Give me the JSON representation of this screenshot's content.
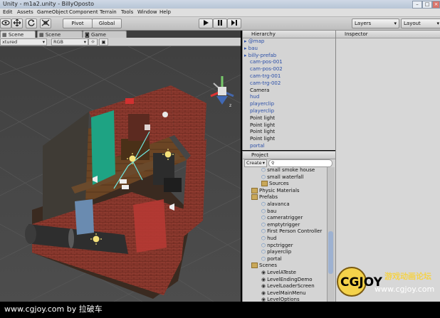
{
  "window": {
    "title": "Unity - m1a2.unity - BillyOposto"
  },
  "menu": [
    "Edit",
    "Assets",
    "GameObject",
    "Component",
    "Terrain",
    "Tools",
    "Window",
    "Help"
  ],
  "toolbar": {
    "pivot": "Pivot",
    "global": "Global",
    "layers": "Layers",
    "layout": "Layout"
  },
  "scene": {
    "tab_scene": "Scene",
    "tab_game": "Game",
    "shading": "xtured",
    "render_mode": "RGB"
  },
  "hierarchy": {
    "title": "Hierarchy",
    "items": [
      {
        "label": "@map",
        "color": "#2b4fa8"
      },
      {
        "label": "bau",
        "color": "#2b4fa8"
      },
      {
        "label": "billy-prefab",
        "color": "#2b4fa8"
      },
      {
        "label": "cam-pos-001",
        "color": "#2b4fa8"
      },
      {
        "label": "cam-pos-002",
        "color": "#2b4fa8"
      },
      {
        "label": "cam-trg-001",
        "color": "#2b4fa8"
      },
      {
        "label": "cam-trg-002",
        "color": "#2b4fa8"
      },
      {
        "label": "Camera",
        "color": "#111111"
      },
      {
        "label": "hud",
        "color": "#2b4fa8"
      },
      {
        "label": "playerclip",
        "color": "#2b4fa8"
      },
      {
        "label": "playerclip",
        "color": "#2b4fa8"
      },
      {
        "label": "Point light",
        "color": "#111111"
      },
      {
        "label": "Point light",
        "color": "#111111"
      },
      {
        "label": "Point light",
        "color": "#111111"
      },
      {
        "label": "Point light",
        "color": "#111111"
      },
      {
        "label": "portal",
        "color": "#2b4fa8"
      }
    ]
  },
  "project": {
    "title": "Project",
    "create": "Create",
    "items": [
      {
        "label": "small smoke house",
        "level": 2,
        "kind": "asset"
      },
      {
        "label": "small waterfall",
        "level": 2,
        "kind": "asset"
      },
      {
        "label": "Sources",
        "level": 2,
        "kind": "folder"
      },
      {
        "label": "Physic Materials",
        "level": 1,
        "kind": "folder"
      },
      {
        "label": "Prefabs",
        "level": 1,
        "kind": "folder"
      },
      {
        "label": "alavanca",
        "level": 2,
        "kind": "asset"
      },
      {
        "label": "bau",
        "level": 2,
        "kind": "asset"
      },
      {
        "label": "cameratrigger",
        "level": 2,
        "kind": "asset"
      },
      {
        "label": "emptytrigger",
        "level": 2,
        "kind": "asset"
      },
      {
        "label": "First Person Controller",
        "level": 2,
        "kind": "asset"
      },
      {
        "label": "hud",
        "level": 2,
        "kind": "asset"
      },
      {
        "label": "npctrigger",
        "level": 2,
        "kind": "asset"
      },
      {
        "label": "playerclip",
        "level": 2,
        "kind": "asset"
      },
      {
        "label": "portal",
        "level": 2,
        "kind": "asset"
      },
      {
        "label": "Scenes",
        "level": 1,
        "kind": "folder"
      },
      {
        "label": "LevelATeste",
        "level": 2,
        "kind": "scene"
      },
      {
        "label": "LevelEndingDemo",
        "level": 2,
        "kind": "scene"
      },
      {
        "label": "LevelLoaderScreen",
        "level": 2,
        "kind": "scene"
      },
      {
        "label": "LevelMainMenu",
        "level": 2,
        "kind": "scene"
      },
      {
        "label": "LevelOptions",
        "level": 2,
        "kind": "scene"
      }
    ]
  },
  "inspector": {
    "title": "Inspector"
  },
  "watermark": {
    "brand": "CGJOY",
    "tagline": "游戏动画论坛",
    "site": "www.cgjoy.com"
  },
  "footer": {
    "text": "www.cgjoy.com by 拉破车"
  }
}
